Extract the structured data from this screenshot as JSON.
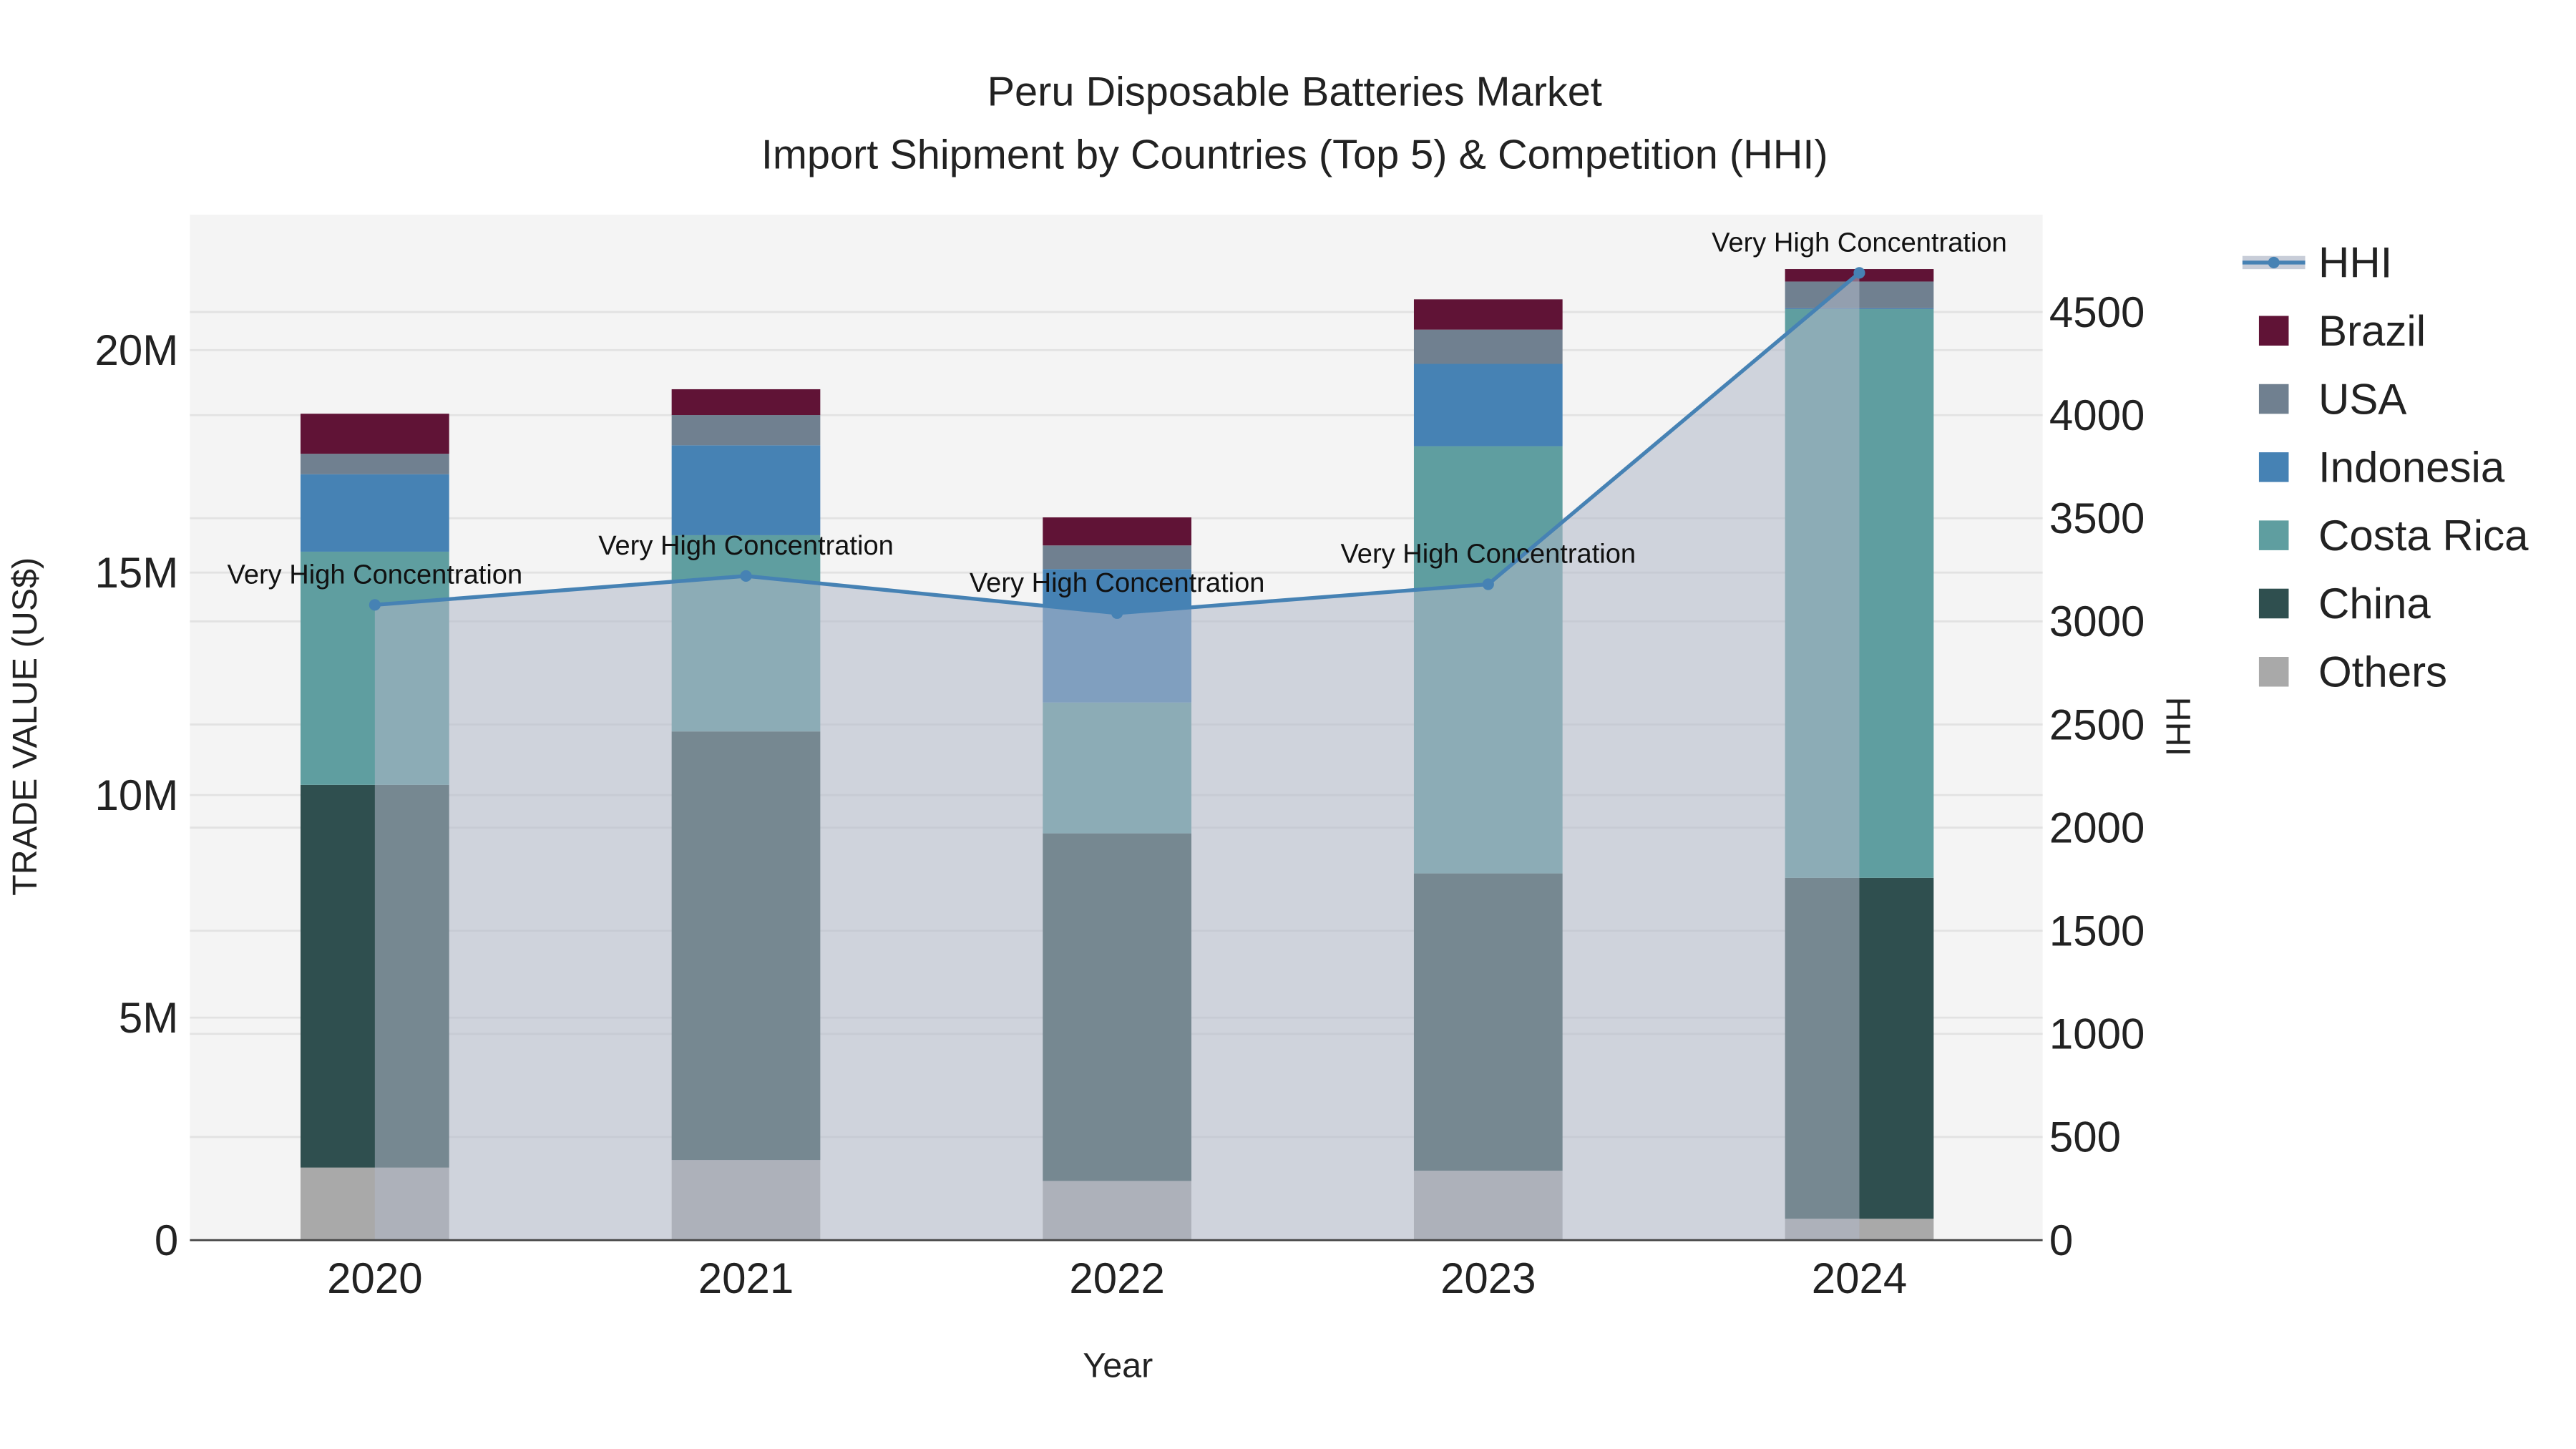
{
  "chart_data": {
    "type": "bar",
    "title": "Peru Disposable Batteries Market",
    "subtitle": "Import Shipment by Countries (Top 5) & Competition (HHI)",
    "xlabel": "Year",
    "ylabel": "TRADE VALUE (US$)",
    "y2label": "HHI",
    "categories": [
      "2020",
      "2021",
      "2022",
      "2023",
      "2024"
    ],
    "ylim": [
      0,
      23000000
    ],
    "y_ticks": [
      0,
      5000000,
      10000000,
      15000000,
      20000000
    ],
    "y_tick_labels": [
      "0",
      "5M",
      "10M",
      "15M",
      "20M"
    ],
    "y2lim": [
      0,
      4970
    ],
    "y2_ticks": [
      0,
      500,
      1000,
      1500,
      2000,
      2500,
      3000,
      3500,
      4000,
      4500
    ],
    "y2_tick_labels": [
      "0",
      "500",
      "1000",
      "1500",
      "2000",
      "2500",
      "3000",
      "3500",
      "4000",
      "4500"
    ],
    "grid": true,
    "legend_position": "right",
    "series": [
      {
        "name": "Others",
        "color": "#a9a9a9",
        "values": [
          1630000,
          1800000,
          1330000,
          1560000,
          480000
        ]
      },
      {
        "name": "China",
        "color": "#2f4f4f",
        "values": [
          8600000,
          9630000,
          7810000,
          6680000,
          7660000
        ]
      },
      {
        "name": "Costa Rica",
        "color": "#5f9ea0",
        "values": [
          5240000,
          4410000,
          2940000,
          9600000,
          12780000
        ]
      },
      {
        "name": "Indonesia",
        "color": "#4682b4",
        "values": [
          1740000,
          2020000,
          3000000,
          1850000,
          20000
        ]
      },
      {
        "name": "USA",
        "color": "#708090",
        "values": [
          460000,
          680000,
          530000,
          770000,
          600000
        ]
      },
      {
        "name": "Brazil",
        "color": "#601336",
        "values": [
          900000,
          580000,
          630000,
          680000,
          280000
        ]
      }
    ],
    "hhi": {
      "name": "HHI",
      "color": "#4682b4",
      "values": [
        3080,
        3220,
        3040,
        3180,
        4690
      ],
      "annotations": [
        "Very High Concentration",
        "Very High Concentration",
        "Very High Concentration",
        "Very High Concentration",
        "Very High Concentration"
      ]
    },
    "legend_order": [
      "HHI",
      "Brazil",
      "USA",
      "Indonesia",
      "Costa Rica",
      "China",
      "Others"
    ]
  }
}
